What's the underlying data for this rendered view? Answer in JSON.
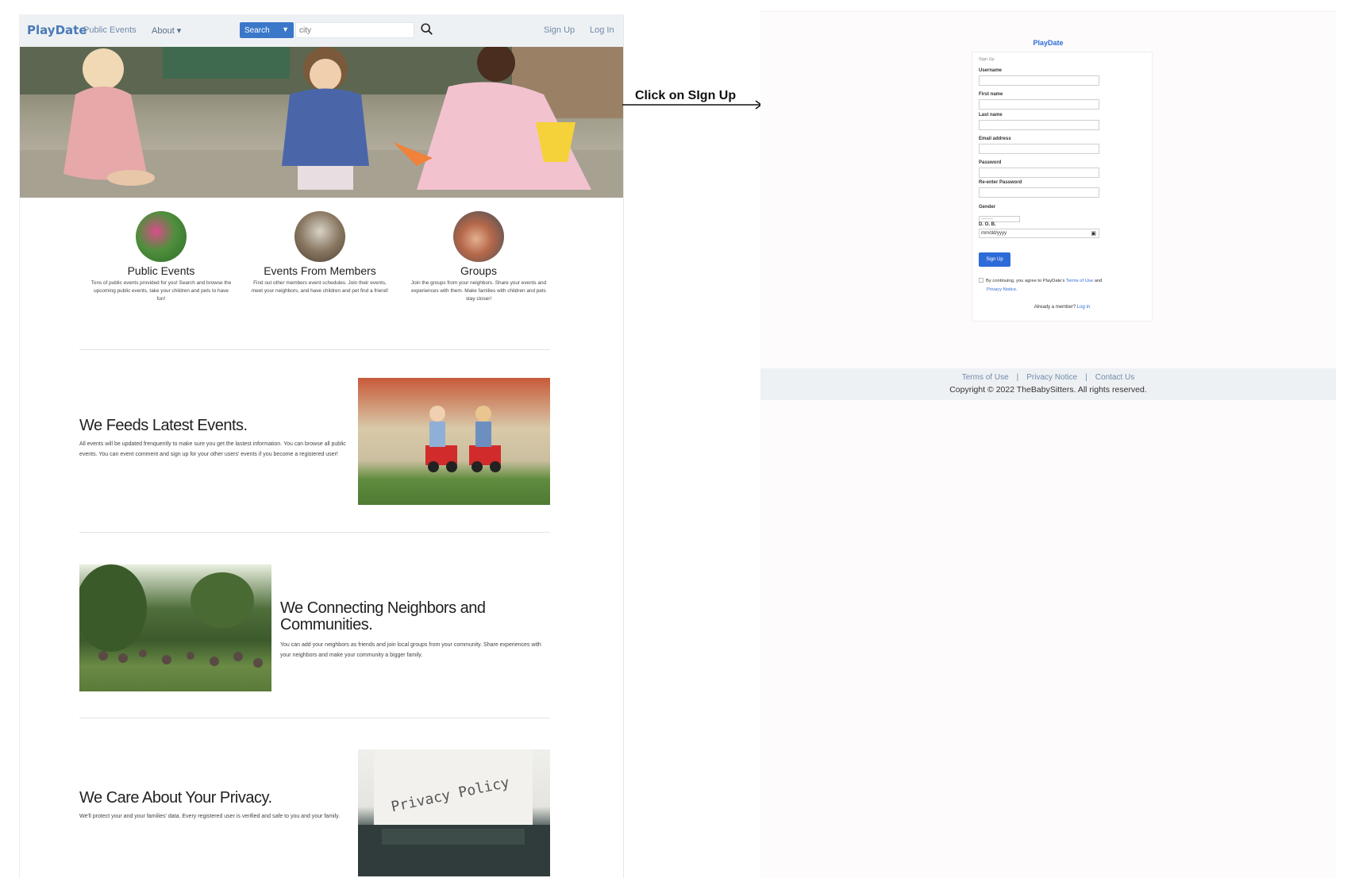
{
  "landing": {
    "brand": "PlayDate",
    "nav": {
      "public_events": "Public Events",
      "about": "About ▾",
      "search_label": "Search",
      "city_placeholder": "city",
      "sign_up": "Sign Up",
      "log_in": "Log In"
    },
    "features": [
      {
        "title": "Public Events",
        "text": "Tons of public events provided for you! Search and browse the upcoming public events, take your children and pets to have fun!"
      },
      {
        "title": "Events From Members",
        "text": "Find out other members event schedules. Join their events, meet your neighbors, and have children and pet find a friend!"
      },
      {
        "title": "Groups",
        "text": "Join the groups from your neighbors. Share your events and experiences with them. Make families with children and pets stay closer!"
      }
    ],
    "sections": [
      {
        "title": "We Feeds Latest Events.",
        "text": "All events will be updated frenquently to make sure you get the lastest information. You can browse all public events. You can event comment and sign up for your other users' events if you become a registered user!"
      },
      {
        "title": "We Connecting Neighbors and Communities.",
        "text": "You can add your neighbors as friends and join local groups from your community. Share experiences with your neighbors and make your community a bigger family."
      },
      {
        "title": "We Care About Your Privacy.",
        "text": "We'll protect your and your families' data. Every registered user is verified and safe to you and your family."
      }
    ],
    "privacy_image_text": "Privacy Policy"
  },
  "arrow": {
    "label": "Click on SIgn Up"
  },
  "signup": {
    "brand": "PlayDate",
    "card_title": "Sign Up",
    "fields": {
      "username": "Username",
      "first_name": "First name",
      "last_name": "Last name",
      "email": "Email address",
      "password": "Password",
      "re_password": "Re-enter Password",
      "gender": "Gender",
      "gender_value": "---------",
      "dob": "D. O. B.",
      "dob_placeholder": "mm/dd/yyyy"
    },
    "button": "Sign Up",
    "agree_prefix": "By continuing, you agree to PlayDate's",
    "terms_link": "Terms of Use",
    "agree_and": "and",
    "privacy_link": "Privacy Notice.",
    "member_text": "Already a member?",
    "login_link": "Log in"
  },
  "footer": {
    "terms": "Terms of Use",
    "privacy": "Privacy Notice",
    "contact": "Contact Us",
    "copyright": "Copyright © 2022 TheBabySitters. All rights reserved."
  },
  "colors": {
    "accent": "#3b78c9",
    "brand_blue": "#2d6bd8",
    "nav_bg": "#eef1f4"
  },
  "icons": [
    "search-icon",
    "calendar-icon",
    "arrow-right-icon"
  ]
}
